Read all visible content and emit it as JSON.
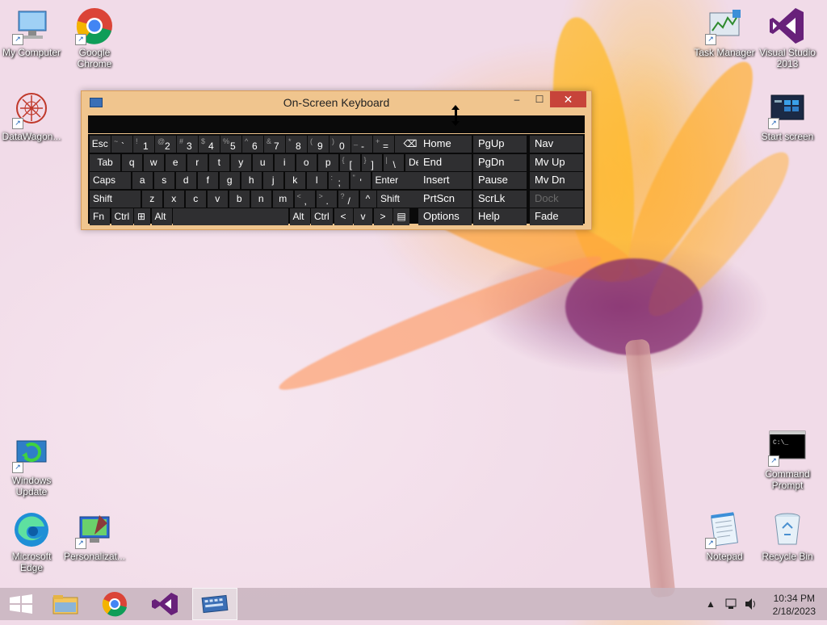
{
  "desktop": {
    "icons_left": [
      {
        "label": "My Computer"
      },
      {
        "label": "Google Chrome"
      },
      {
        "label": "DataWagon..."
      },
      {
        "label": "Windows Update"
      },
      {
        "label": "Microsoft Edge"
      },
      {
        "label": "Personalizat..."
      }
    ],
    "icons_right": [
      {
        "label": "Task Manager"
      },
      {
        "label": "Visual Studio 2013"
      },
      {
        "label": "Start screen"
      },
      {
        "label": "Command Prompt"
      },
      {
        "label": "Notepad"
      },
      {
        "label": "Recycle Bin"
      }
    ]
  },
  "osk": {
    "title": "On-Screen Keyboard",
    "minimize": "–",
    "maximize": "☐",
    "close": "✕",
    "row1": [
      {
        "sup": "",
        "main": "Esc"
      },
      {
        "sup": "~",
        "main": "`"
      },
      {
        "sup": "!",
        "main": "1"
      },
      {
        "sup": "@",
        "main": "2"
      },
      {
        "sup": "#",
        "main": "3"
      },
      {
        "sup": "$",
        "main": "4"
      },
      {
        "sup": "%",
        "main": "5"
      },
      {
        "sup": "^",
        "main": "6"
      },
      {
        "sup": "&",
        "main": "7"
      },
      {
        "sup": "*",
        "main": "8"
      },
      {
        "sup": "(",
        "main": "9"
      },
      {
        "sup": ")",
        "main": "0"
      },
      {
        "sup": "_",
        "main": "-"
      },
      {
        "sup": "+",
        "main": "="
      },
      {
        "sup": "",
        "main": "⌫"
      }
    ],
    "row2": [
      "Tab",
      "q",
      "w",
      "e",
      "r",
      "t",
      "y",
      "u",
      "i",
      "o",
      "p",
      "[",
      "]",
      "\\",
      "Del"
    ],
    "row2_sup": [
      "",
      "",
      "",
      "",
      "",
      "",
      "",
      "",
      "",
      "",
      "",
      "{",
      "}",
      "|",
      ""
    ],
    "row3": [
      "Caps",
      "a",
      "s",
      "d",
      "f",
      "g",
      "h",
      "j",
      "k",
      "l",
      ";",
      "'",
      "Enter"
    ],
    "row3_sup": [
      "",
      "",
      "",
      "",
      "",
      "",
      "",
      "",
      "",
      "",
      ":",
      "\"",
      ""
    ],
    "row4": [
      "Shift",
      "z",
      "x",
      "c",
      "v",
      "b",
      "n",
      "m",
      ",",
      ".",
      "/",
      "^",
      "Shift"
    ],
    "row4_sup": [
      "",
      "",
      "",
      "",
      "",
      "",
      "",
      "",
      "<",
      ">",
      "?",
      "",
      ""
    ],
    "row5": [
      "Fn",
      "Ctrl",
      "⊞",
      "Alt",
      "",
      "Alt",
      "Ctrl",
      "<",
      "v",
      ">",
      "▤"
    ],
    "nav_keys": [
      [
        "Home",
        "PgUp",
        "Nav"
      ],
      [
        "End",
        "PgDn",
        "Mv Up"
      ],
      [
        "Insert",
        "Pause",
        "Mv Dn"
      ],
      [
        "PrtScn",
        "ScrLk",
        "Dock"
      ],
      [
        "Options",
        "Help",
        "Fade"
      ]
    ]
  },
  "taskbar": {
    "items": [
      "Start",
      "File Explorer",
      "Google Chrome",
      "Visual Studio",
      "On-Screen Keyboard"
    ],
    "time": "10:34 PM",
    "date": "2/18/2023"
  }
}
